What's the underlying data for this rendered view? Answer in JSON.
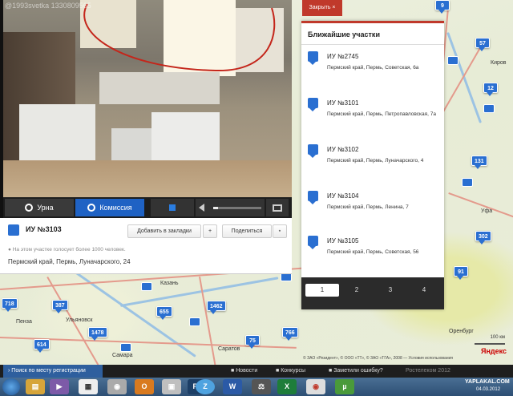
{
  "watermark": "@1993svetka 1330809565",
  "close_button": "Закрыть ×",
  "video_controls": {
    "urn_label": "Урна",
    "commission_label": "Комиссия",
    "volume_level": 0.1
  },
  "station": {
    "name": "ИУ №3103",
    "add_bookmark_label": "Добавить в закладки",
    "add_icon_symbol": "+",
    "share_label": "Поделиться",
    "voters_note": "На этом участке голосует более 1000 человек.",
    "address": "Пермский край, Пермь, Луначарского, 24"
  },
  "nearest": {
    "title": "Ближайшие участки",
    "items": [
      {
        "name": "ИУ №2745",
        "address": "Пермский край, Пермь, Советская, 6а"
      },
      {
        "name": "ИУ №3101",
        "address": "Пермский край, Пермь, Петропавловская, 7а"
      },
      {
        "name": "ИУ №3102",
        "address": "Пермский край, Пермь, Луначарского, 4"
      },
      {
        "name": "ИУ №3104",
        "address": "Пермский край, Пермь, Ленина, 7"
      },
      {
        "name": "ИУ №3105",
        "address": "Пермский край, Пермь, Советская, 56"
      }
    ],
    "pages": [
      "1",
      "2",
      "3",
      "4"
    ],
    "active_page": "1"
  },
  "map": {
    "markers": [
      "9",
      "57",
      "12",
      "131",
      "302",
      "91",
      "718",
      "387",
      "655",
      "1462",
      "1478",
      "614",
      "75",
      "766"
    ],
    "cities": [
      "Ульяновск",
      "Самара",
      "Саратов",
      "Пенза",
      "Казань",
      "Киров",
      "Уфа",
      "Оренбург"
    ],
    "scale": "100 км",
    "logo": "Яндекс",
    "copyright": "© ЗАО «Резидент», © ООО «ТТ», © ЗАО «ТГА», 2008 — Условия использования"
  },
  "footer": {
    "search_label": "Поиск по месту регистрации",
    "news_label": "Новости",
    "contests_label": "Конкурсы",
    "error_label": "Заметили ошибку?",
    "brand": "Ростелеком 2012"
  },
  "taskbar": {
    "clock": "04.03.2012",
    "watermark": "YAPLAKAL.COM"
  },
  "colors": {
    "accent": "#c0392b",
    "marker": "#2a6fd1",
    "taskbar": "#2d4f74"
  }
}
